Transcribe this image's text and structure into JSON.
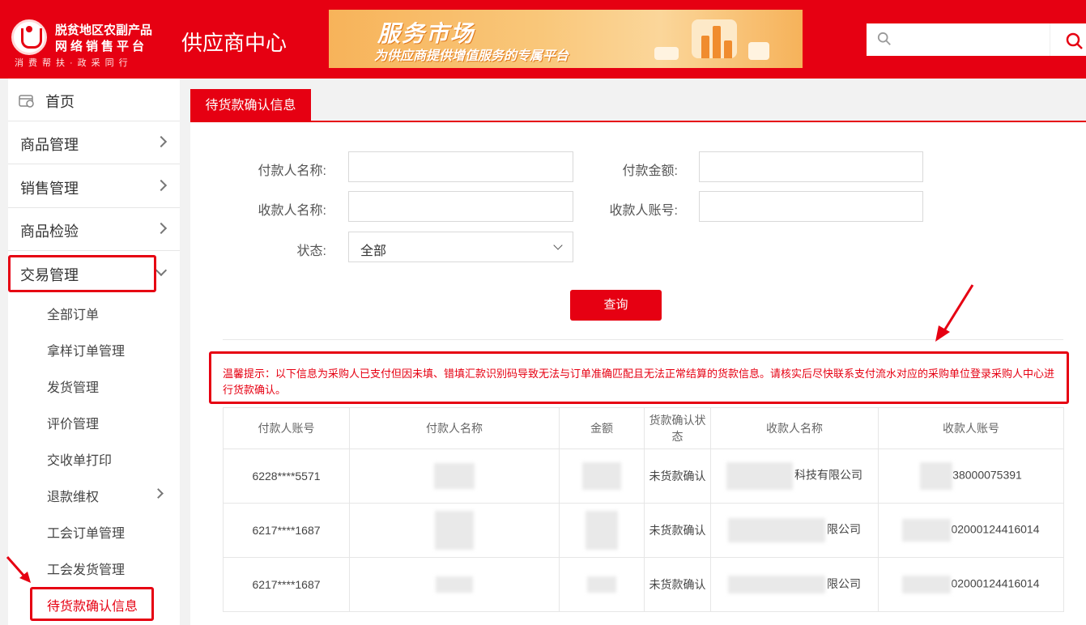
{
  "header": {
    "logo_line1": "脱贫地区农副产品",
    "logo_line2": "网络销售平台",
    "logo_line3": "消费帮扶·政采同行",
    "site_title": "供应商中心",
    "banner_title": "服务市场",
    "banner_subtitle": "为供应商提供增值服务的专属平台",
    "search_placeholder": ""
  },
  "sidebar": {
    "home": "首页",
    "items": [
      {
        "label": "商品管理"
      },
      {
        "label": "销售管理"
      },
      {
        "label": "商品检验"
      },
      {
        "label": "交易管理"
      }
    ],
    "sub_items": [
      {
        "label": "全部订单"
      },
      {
        "label": "拿样订单管理"
      },
      {
        "label": "发货管理"
      },
      {
        "label": "评价管理"
      },
      {
        "label": "交收单打印"
      },
      {
        "label": "退款维权"
      },
      {
        "label": "工会订单管理"
      },
      {
        "label": "工会发货管理"
      },
      {
        "label": "待货款确认信息"
      }
    ]
  },
  "main": {
    "tab": "待货款确认信息",
    "form": {
      "payer_name_label": "付款人名称:",
      "payer_name_value": "",
      "amount_label": "付款金额:",
      "amount_value": "",
      "payee_name_label": "收款人名称:",
      "payee_name_value": "",
      "payee_account_label": "收款人账号:",
      "payee_account_value": "",
      "status_label": "状态:",
      "status_value": "全部"
    },
    "query_button": "查询",
    "notice": "温馨提示：以下信息为采购人已支付但因未填、错填汇款识别码导致无法与订单准确匹配且无法正常结算的货款信息。请核实后尽快联系支付流水对应的采购单位登录采购人中心进行货款确认。",
    "table": {
      "headers": [
        "付款人账号",
        "付款人名称",
        "金额",
        "货款确认状态",
        "收款人名称",
        "收款人账号"
      ],
      "rows": [
        {
          "payer_account": "6228****5571",
          "payer_name": "",
          "amount": "",
          "status": "未货款确认",
          "payee_name": "科技有限公司",
          "payee_account": "38000075391"
        },
        {
          "payer_account": "6217****1687",
          "payer_name": "",
          "amount": "",
          "status": "未货款确认",
          "payee_name": "限公司",
          "payee_account": "02000124416014"
        },
        {
          "payer_account": "6217****1687",
          "payer_name": "",
          "amount": "",
          "status": "未货款确认",
          "payee_name": "限公司",
          "payee_account": "02000124416014"
        }
      ]
    }
  },
  "colors": {
    "brand_red": "#e60012",
    "banner_orange": "#f9c77a"
  }
}
